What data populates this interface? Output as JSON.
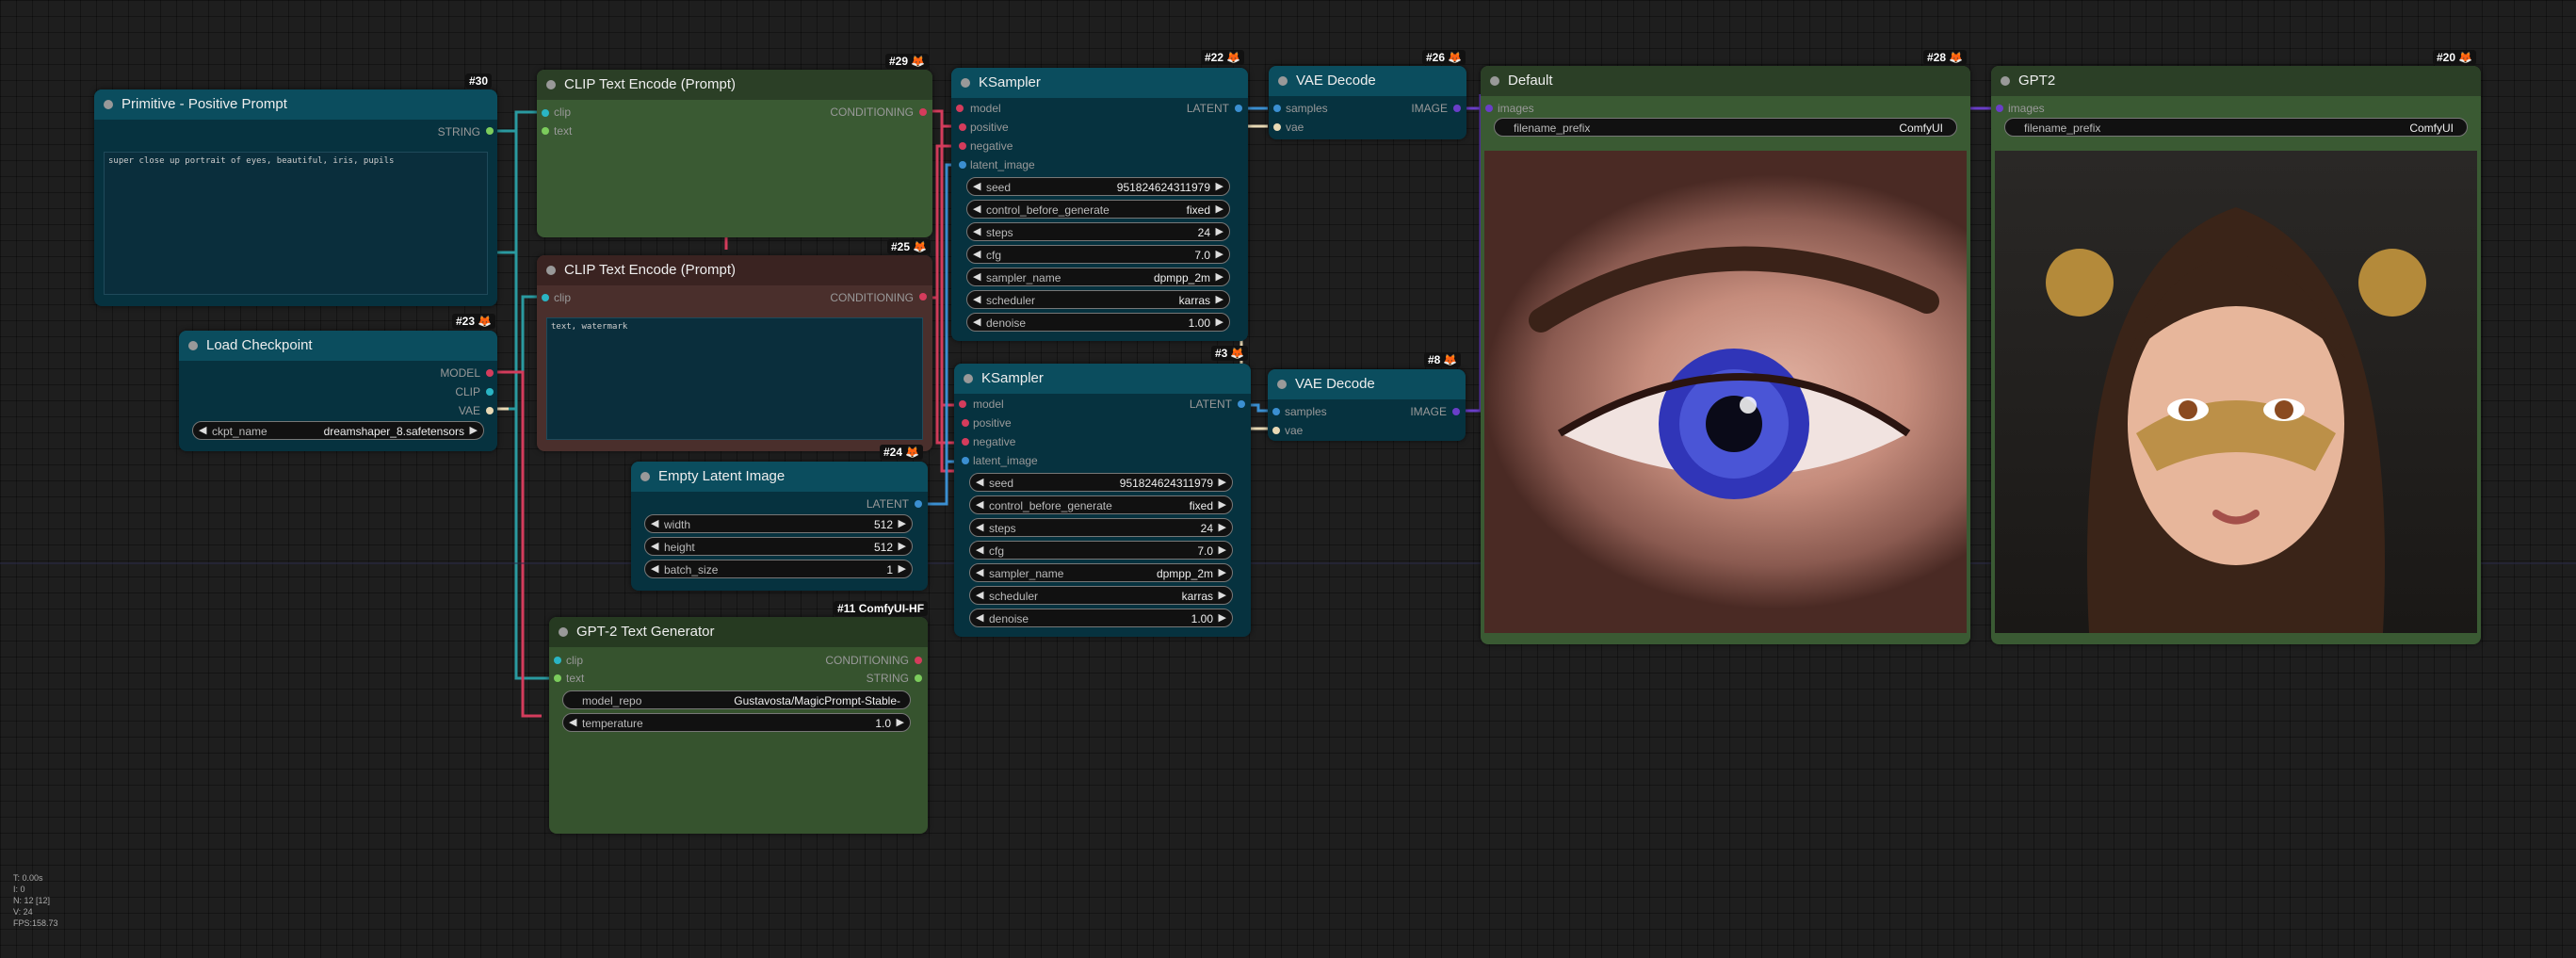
{
  "nodes": {
    "primitive": {
      "badge": "#30",
      "title": "Primitive - Positive Prompt",
      "out": "STRING",
      "text": "super close up portrait of eyes, beautiful, iris, pupils"
    },
    "clip_pos": {
      "badge": "#29",
      "title": "CLIP Text Encode (Prompt)",
      "in_clip": "clip",
      "in_text": "text",
      "out": "CONDITIONING"
    },
    "clip_neg": {
      "badge": "#25",
      "title": "CLIP Text Encode (Prompt)",
      "in_clip": "clip",
      "out": "CONDITIONING",
      "text": "text, watermark"
    },
    "checkpoint": {
      "badge": "#23",
      "title": "Load Checkpoint",
      "out_model": "MODEL",
      "out_clip": "CLIP",
      "out_vae": "VAE",
      "ckpt_label": "ckpt_name",
      "ckpt_value": "dreamshaper_8.safetensors"
    },
    "latent": {
      "badge": "#24",
      "title": "Empty Latent Image",
      "out": "LATENT",
      "widgets": [
        {
          "label": "width",
          "value": "512"
        },
        {
          "label": "height",
          "value": "512"
        },
        {
          "label": "batch_size",
          "value": "1"
        }
      ]
    },
    "gpt2gen": {
      "badge": "#11 ComfyUI-HF",
      "title": "GPT-2 Text Generator",
      "in_clip": "clip",
      "in_text": "text",
      "out_cond": "CONDITIONING",
      "out_string": "STRING",
      "widgets": [
        {
          "label": "model_repo",
          "value": "Gustavosta/MagicPrompt-Stable-"
        },
        {
          "label": "temperature",
          "value": "1.0"
        }
      ]
    },
    "ksampler1": {
      "badge": "#22",
      "title": "KSampler",
      "in_model": "model",
      "in_positive": "positive",
      "in_negative": "negative",
      "in_latent": "latent_image",
      "out": "LATENT",
      "widgets": [
        {
          "label": "seed",
          "value": "951824624311979"
        },
        {
          "label": "control_before_generate",
          "value": "fixed"
        },
        {
          "label": "steps",
          "value": "24"
        },
        {
          "label": "cfg",
          "value": "7.0"
        },
        {
          "label": "sampler_name",
          "value": "dpmpp_2m"
        },
        {
          "label": "scheduler",
          "value": "karras"
        },
        {
          "label": "denoise",
          "value": "1.00"
        }
      ]
    },
    "ksampler2": {
      "badge": "#3",
      "title": "KSampler",
      "in_model": "model",
      "in_positive": "positive",
      "in_negative": "negative",
      "in_latent": "latent_image",
      "out": "LATENT",
      "widgets": [
        {
          "label": "seed",
          "value": "951824624311979"
        },
        {
          "label": "control_before_generate",
          "value": "fixed"
        },
        {
          "label": "steps",
          "value": "24"
        },
        {
          "label": "cfg",
          "value": "7.0"
        },
        {
          "label": "sampler_name",
          "value": "dpmpp_2m"
        },
        {
          "label": "scheduler",
          "value": "karras"
        },
        {
          "label": "denoise",
          "value": "1.00"
        }
      ]
    },
    "vae1": {
      "badge": "#26",
      "title": "VAE Decode",
      "in_samples": "samples",
      "in_vae": "vae",
      "out": "IMAGE"
    },
    "vae2": {
      "badge": "#8",
      "title": "VAE Decode",
      "in_samples": "samples",
      "in_vae": "vae",
      "out": "IMAGE"
    },
    "save_default": {
      "badge": "#28",
      "title": "Default",
      "in_images": "images",
      "prefix_label": "filename_prefix",
      "prefix_value": "ComfyUI"
    },
    "save_gpt2": {
      "badge": "#20",
      "title": "GPT2",
      "in_images": "images",
      "prefix_label": "filename_prefix",
      "prefix_value": "ComfyUI"
    }
  },
  "stats": {
    "t": "T: 0.00s",
    "i": "I: 0",
    "n": "N: 12 [12]",
    "v": "V: 24",
    "fps": "FPS:158.73"
  },
  "colors": {
    "clip": "#ffd500",
    "model": "#b39ddb",
    "vae": "#ff6e6e",
    "conditioning": "#ffa931",
    "latent": "#ff9cf9",
    "image": "#64b5f6",
    "string": "#7ccc5c"
  }
}
